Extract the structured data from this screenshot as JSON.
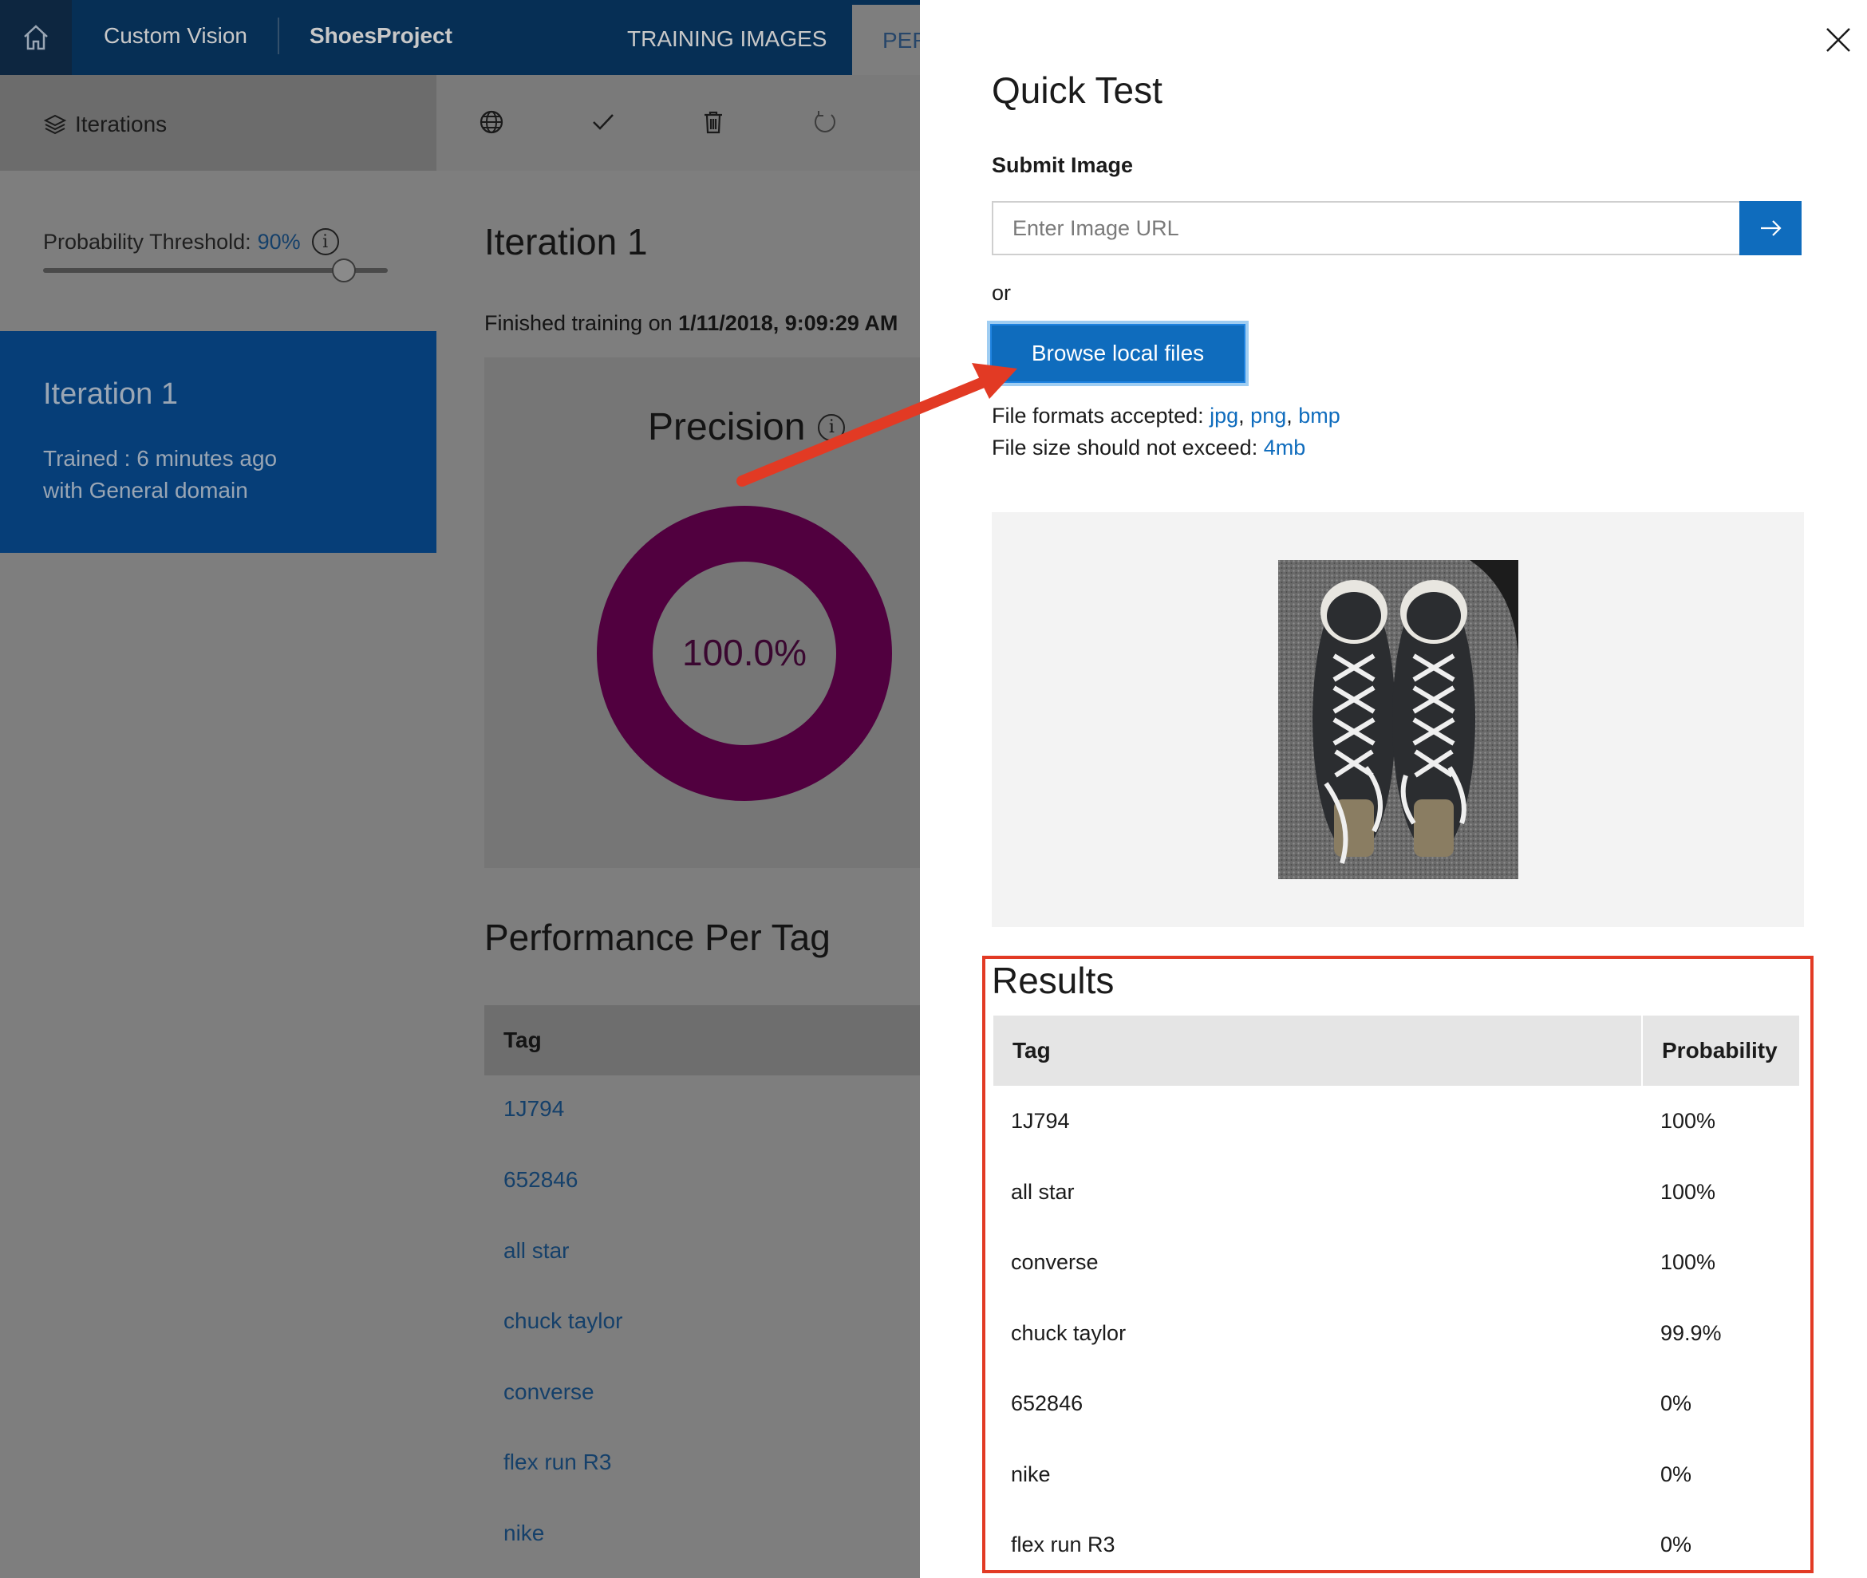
{
  "topbar": {
    "home_icon": "home-icon",
    "app_name": "Custom Vision",
    "project_name": "ShoesProject",
    "tabs": [
      {
        "label": "TRAINING IMAGES"
      },
      {
        "label": "PER"
      }
    ]
  },
  "sidebar": {
    "header_label": "Iterations",
    "header_icon": "layers-icon",
    "threshold_label": "Probability Threshold: ",
    "threshold_value": "90%",
    "threshold_level": 0.9,
    "iteration": {
      "name": "Iteration 1",
      "trained": "Trained : 6 minutes ago",
      "domain": "with General domain"
    }
  },
  "toolbar": {
    "icons": [
      "globe-icon",
      "check-icon",
      "trash-icon",
      "refresh-icon"
    ]
  },
  "main": {
    "title": "Iteration 1",
    "finished_prefix": "Finished training on ",
    "finished_date": "1/11/2018, 9:09:29 AM",
    "precision_label": "Precision",
    "precision_value": "100.0%",
    "precision_fraction": 1.0,
    "performance_title": "Performance Per Tag",
    "table_header": "Tag",
    "tags": [
      "1J794",
      "652846",
      "all star",
      "chuck taylor",
      "converse",
      "flex run R3",
      "nike"
    ]
  },
  "quick_test": {
    "title": "Quick Test",
    "submit_label": "Submit Image",
    "url_placeholder": "Enter Image URL",
    "or_text": "or",
    "browse_label": "Browse local files",
    "formats_label": "File formats accepted: ",
    "formats": [
      "jpg",
      "png",
      "bmp"
    ],
    "size_label": "File size should not exceed: ",
    "size_value": "4mb",
    "results_title": "Results",
    "results_headers": {
      "tag": "Tag",
      "probability": "Probability"
    },
    "results": [
      {
        "tag": "1J794",
        "probability": "100%"
      },
      {
        "tag": "all star",
        "probability": "100%"
      },
      {
        "tag": "converse",
        "probability": "100%"
      },
      {
        "tag": "chuck taylor",
        "probability": "99.9%"
      },
      {
        "tag": "652846",
        "probability": "0%"
      },
      {
        "tag": "nike",
        "probability": "0%"
      },
      {
        "tag": "flex run R3",
        "probability": "0%"
      }
    ]
  },
  "colors": {
    "accent": "#0f6cbd",
    "topbar": "#062f55",
    "precision": "#51003f",
    "annotation": "#e23a24"
  }
}
